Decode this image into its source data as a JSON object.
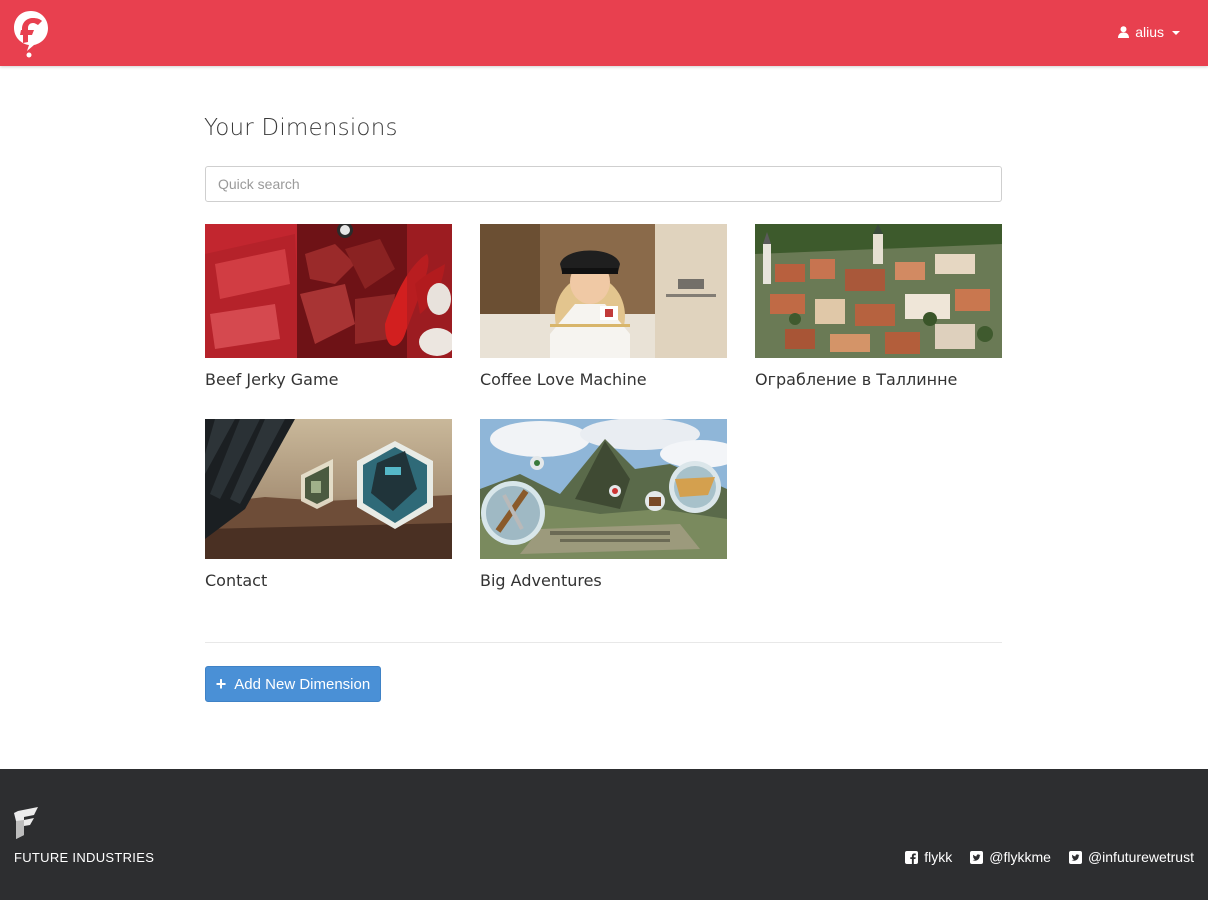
{
  "header": {
    "user": {
      "name": "alius"
    },
    "accent_color": "#e8404f"
  },
  "main": {
    "title": "Your Dimensions",
    "search": {
      "placeholder": "Quick search",
      "value": ""
    },
    "dimensions": [
      {
        "name": "Beef Jerky Game"
      },
      {
        "name": "Coffee Love Machine"
      },
      {
        "name": "Ограбление в Таллинне"
      },
      {
        "name": "Contact"
      },
      {
        "name": "Big Adventures"
      }
    ],
    "add_button": {
      "label": "Add New Dimension",
      "color": "#4a90d6"
    }
  },
  "footer": {
    "company": "FUTURE INDUSTRIES",
    "links": [
      {
        "icon": "facebook-icon",
        "label": "flykk"
      },
      {
        "icon": "twitter-icon",
        "label": "@flykkme"
      },
      {
        "icon": "twitter-icon",
        "label": "@infuturewetrust"
      }
    ],
    "background": "#2d2e30"
  }
}
